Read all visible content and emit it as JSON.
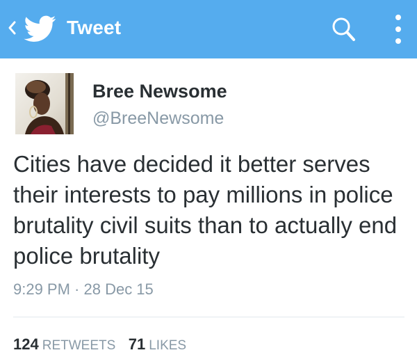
{
  "appbar": {
    "title": "Tweet",
    "background_color": "#55acee",
    "back_icon": "chevron-left-icon",
    "logo_icon": "twitter-bird-icon",
    "search_icon": "search-icon",
    "more_icon": "more-vertical-icon"
  },
  "tweet": {
    "author_name": "Bree Newsome",
    "author_handle": "@BreeNewsome",
    "text": "Cities have decided it better serves their interests to pay millions in police brutality civil suits than to actually end police brutality",
    "timestamp": "9:29 PM · 28 Dec 15",
    "retweets": {
      "count": "124",
      "label": "RETWEETS"
    },
    "likes": {
      "count": "71",
      "label": "LIKES"
    }
  },
  "colors": {
    "primary_text": "#292f33",
    "secondary_text": "#8899a6",
    "divider": "#e1e8ed"
  }
}
